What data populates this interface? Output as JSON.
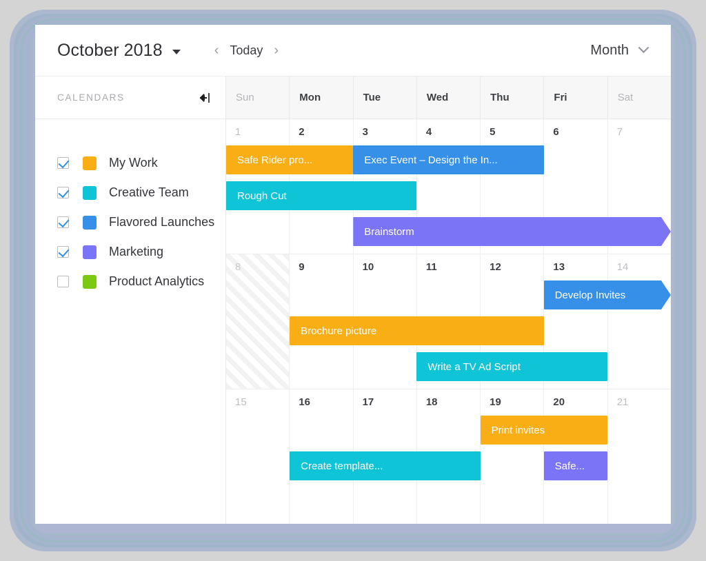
{
  "toolbar": {
    "month_title": "October 2018",
    "prev_label": "‹",
    "today_label": "Today",
    "next_label": "›",
    "view_label": "Month"
  },
  "sidebar": {
    "title": "CALENDARS",
    "collapse_icon": "collapse-panel-icon",
    "calendars": [
      {
        "name": "My Work",
        "color": "#f9ae16",
        "checked": true
      },
      {
        "name": "Creative Team",
        "color": "#0fc4d6",
        "checked": true
      },
      {
        "name": "Flavored Launches",
        "color": "#3690e8",
        "checked": true
      },
      {
        "name": "Marketing",
        "color": "#7b74f7",
        "checked": true
      },
      {
        "name": "Product Analytics",
        "color": "#7cc813",
        "checked": false
      }
    ]
  },
  "grid": {
    "day_headers": [
      {
        "label": "Sun",
        "weekend": true
      },
      {
        "label": "Mon",
        "weekend": false
      },
      {
        "label": "Tue",
        "weekend": false
      },
      {
        "label": "Wed",
        "weekend": false
      },
      {
        "label": "Thu",
        "weekend": false
      },
      {
        "label": "Fri",
        "weekend": false
      },
      {
        "label": "Sat",
        "weekend": true
      }
    ],
    "weeks": [
      {
        "days": [
          {
            "num": "1",
            "weekend": true,
            "blocked": false
          },
          {
            "num": "2",
            "weekend": false,
            "blocked": false
          },
          {
            "num": "3",
            "weekend": false,
            "blocked": false
          },
          {
            "num": "4",
            "weekend": false,
            "blocked": false
          },
          {
            "num": "5",
            "weekend": false,
            "blocked": false
          },
          {
            "num": "6",
            "weekend": false,
            "blocked": false
          },
          {
            "num": "7",
            "weekend": true,
            "blocked": false
          }
        ],
        "events": [
          {
            "title": "Safe Rider pro...",
            "color": "#f9ae16",
            "start": 0,
            "span": 2,
            "row": 0,
            "arrow": false
          },
          {
            "title": "Exec Event – Design the In...",
            "color": "#3690e8",
            "start": 2,
            "span": 3,
            "row": 0,
            "arrow": false
          },
          {
            "title": "Rough Cut",
            "color": "#0fc4d6",
            "start": 0,
            "span": 3,
            "row": 1,
            "arrow": false
          },
          {
            "title": "Brainstorm",
            "color": "#7b74f7",
            "start": 2,
            "span": 5,
            "row": 2,
            "arrow": true
          }
        ]
      },
      {
        "days": [
          {
            "num": "8",
            "weekend": true,
            "blocked": true
          },
          {
            "num": "9",
            "weekend": false,
            "blocked": false
          },
          {
            "num": "10",
            "weekend": false,
            "blocked": false
          },
          {
            "num": "11",
            "weekend": false,
            "blocked": false
          },
          {
            "num": "12",
            "weekend": false,
            "blocked": false
          },
          {
            "num": "13",
            "weekend": false,
            "blocked": false
          },
          {
            "num": "14",
            "weekend": true,
            "blocked": false
          }
        ],
        "events": [
          {
            "title": "Develop Invites",
            "color": "#3690e8",
            "start": 5,
            "span": 2,
            "row": 0,
            "arrow": true
          },
          {
            "title": "Brochure picture",
            "color": "#f9ae16",
            "start": 1,
            "span": 4,
            "row": 1,
            "arrow": false
          },
          {
            "title": "Write a TV Ad Script",
            "color": "#0fc4d6",
            "start": 3,
            "span": 3,
            "row": 2,
            "arrow": false
          }
        ]
      },
      {
        "days": [
          {
            "num": "15",
            "weekend": true,
            "blocked": false
          },
          {
            "num": "16",
            "weekend": false,
            "blocked": false
          },
          {
            "num": "17",
            "weekend": false,
            "blocked": false
          },
          {
            "num": "18",
            "weekend": false,
            "blocked": false
          },
          {
            "num": "19",
            "weekend": false,
            "blocked": false
          },
          {
            "num": "20",
            "weekend": false,
            "blocked": false
          },
          {
            "num": "21",
            "weekend": true,
            "blocked": false
          }
        ],
        "events": [
          {
            "title": "Print invites",
            "color": "#f9ae16",
            "start": 4,
            "span": 2,
            "row": 0,
            "arrow": false
          },
          {
            "title": "Create template...",
            "color": "#0fc4d6",
            "start": 1,
            "span": 3,
            "row": 1,
            "arrow": false
          },
          {
            "title": "Safe...",
            "color": "#7b74f7",
            "start": 5,
            "span": 1,
            "row": 1,
            "arrow": false
          }
        ]
      }
    ]
  }
}
